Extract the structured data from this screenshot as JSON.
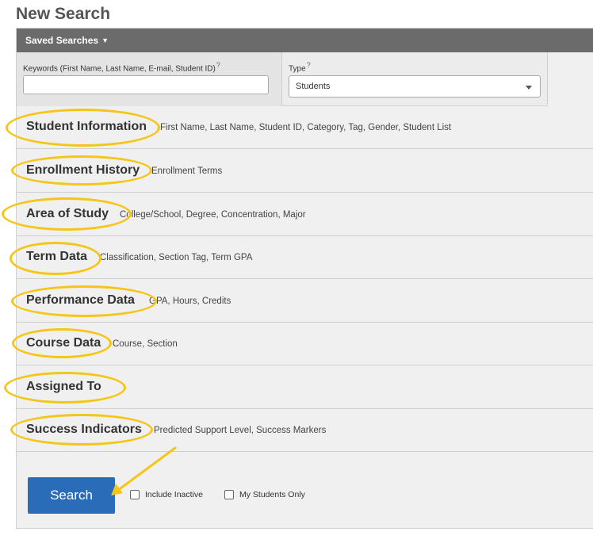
{
  "page_title": "New Search",
  "saved_searches_label": "Saved Searches",
  "keywords": {
    "label": "Keywords (First Name, Last Name, E-mail, Student ID)",
    "help": "?",
    "value": ""
  },
  "type": {
    "label": "Type",
    "help": "?",
    "value": "Students"
  },
  "sections": [
    {
      "title": "Student Information",
      "desc": "First Name, Last Name, Student ID, Category, Tag, Gender, Student List"
    },
    {
      "title": "Enrollment History",
      "desc": "Enrollment Terms"
    },
    {
      "title": "Area of Study",
      "desc": "College/School, Degree, Concentration, Major"
    },
    {
      "title": "Term Data",
      "desc": "Classification, Section Tag, Term GPA"
    },
    {
      "title": "Performance Data",
      "desc": "GPA, Hours, Credits"
    },
    {
      "title": "Course Data",
      "desc": "Course, Section"
    },
    {
      "title": "Assigned To",
      "desc": ""
    },
    {
      "title": "Success Indicators",
      "desc": "Predicted Support Level, Success Markers"
    }
  ],
  "search_button": "Search",
  "include_inactive": "Include Inactive",
  "my_students_only": "My Students Only",
  "colors": {
    "highlight": "#f5c518",
    "header_bar": "#6b6b6b",
    "button": "#2b6cb8"
  }
}
